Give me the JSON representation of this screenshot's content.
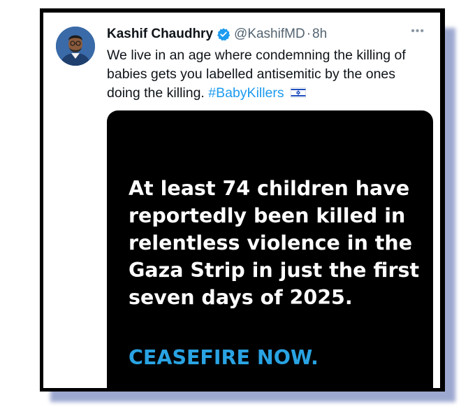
{
  "tweet": {
    "author_name": "Kashif Chaudhry",
    "handle": "@KashifMD",
    "separator": "·",
    "time": "8h",
    "more_label": "•••",
    "verified_icon": "verified-badge-icon",
    "text_main": "We live in an age where condemning the killing of babies gets you labelled antisemitic by the ones doing the killing.",
    "hashtag": "#BabyKillers",
    "flag_icon": "israel-flag-icon"
  },
  "media": {
    "headline": "At least 74 children have reportedly been killed in relentless violence in the Gaza Strip in just the first seven days of 2025.",
    "cta": "CEASEFIRE NOW."
  },
  "colors": {
    "link": "#1d9bf0",
    "cta": "#29a3e3",
    "frame": "#000000",
    "shadow": "#8d9ac8"
  }
}
